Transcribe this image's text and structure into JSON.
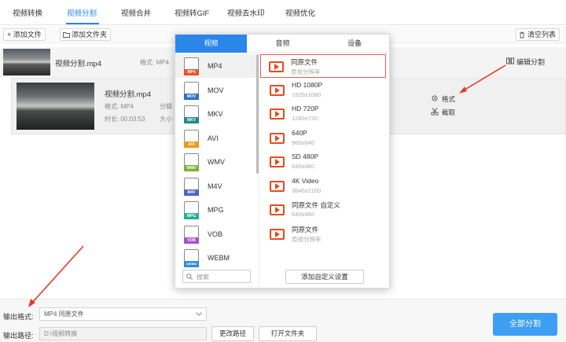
{
  "top_tabs": [
    {
      "label": "视频转换",
      "active": false
    },
    {
      "label": "视频分割",
      "active": true
    },
    {
      "label": "视频合并",
      "active": false
    },
    {
      "label": "视频转GIF",
      "active": false
    },
    {
      "label": "视频去水印",
      "active": false
    },
    {
      "label": "视频优化",
      "active": false
    }
  ],
  "toolbar": {
    "add_file": "+ 添加文件",
    "add_folder": "添加文件夹",
    "clear_list": "清空列表"
  },
  "files": [
    {
      "name": "视频分割.mp4",
      "format_label": "格式: MP4",
      "action": "编辑分割"
    },
    {
      "name": "视频分割.mp4",
      "format_label": "格式: MP4",
      "split_label": "分辑",
      "duration_label": "时长: 00:03:53",
      "size_label": "大小",
      "format_action": "格式",
      "cut_action": "截取"
    }
  ],
  "dropdown": {
    "tabs": [
      {
        "label": "视频",
        "active": true
      },
      {
        "label": "音频",
        "active": false
      },
      {
        "label": "设备",
        "active": false
      }
    ],
    "formats": [
      {
        "label": "MP4",
        "tag": "MP4",
        "tag_color": "#e8542b",
        "selected": true
      },
      {
        "label": "MOV",
        "tag": "MOV",
        "tag_color": "#2c6fd1",
        "selected": false
      },
      {
        "label": "MKV",
        "tag": "MKV",
        "tag_color": "#1e8a86",
        "selected": false
      },
      {
        "label": "AVI",
        "tag": "AVI",
        "tag_color": "#f09a1c",
        "selected": false
      },
      {
        "label": "WMV",
        "tag": "WMV",
        "tag_color": "#7bb338",
        "selected": false
      },
      {
        "label": "M4V",
        "tag": "M4V",
        "tag_color": "#4b63c6",
        "selected": false
      },
      {
        "label": "MPG",
        "tag": "MPG",
        "tag_color": "#26b08c",
        "selected": false
      },
      {
        "label": "VOB",
        "tag": "VOB",
        "tag_color": "#a24fcf",
        "selected": false
      },
      {
        "label": "WEBM",
        "tag": "WEBM",
        "tag_color": "#3a8ad6",
        "selected": false
      }
    ],
    "search_placeholder": "搜索",
    "presets": [
      {
        "name": "同原文件",
        "sub": "原视分辨率",
        "selected": true
      },
      {
        "name": "HD 1080P",
        "sub": "1920x1080",
        "selected": false
      },
      {
        "name": "HD 720P",
        "sub": "1280x720",
        "selected": false
      },
      {
        "name": "640P",
        "sub": "960x640",
        "selected": false
      },
      {
        "name": "SD 480P",
        "sub": "640x480",
        "selected": false
      },
      {
        "name": "4K Video",
        "sub": "3840x2160",
        "selected": false
      },
      {
        "name": "同原文件 自定义",
        "sub": "640x480",
        "selected": false
      },
      {
        "name": "同原文件",
        "sub": "原视分辨率",
        "selected": false
      }
    ],
    "custom_button": "添加自定义设置"
  },
  "bottom": {
    "output_format_label": "输出格式:",
    "output_format_value": "MP4  同原文件",
    "output_path_label": "输出路径:",
    "output_path_value": "D:\\视频转换",
    "change_path": "更改路径",
    "open_folder": "打开文件夹",
    "split_all": "全部分割"
  },
  "colors": {
    "accent": "#2a86e8",
    "highlight": "#e33a2c",
    "primary_button": "#3e9ef2"
  }
}
